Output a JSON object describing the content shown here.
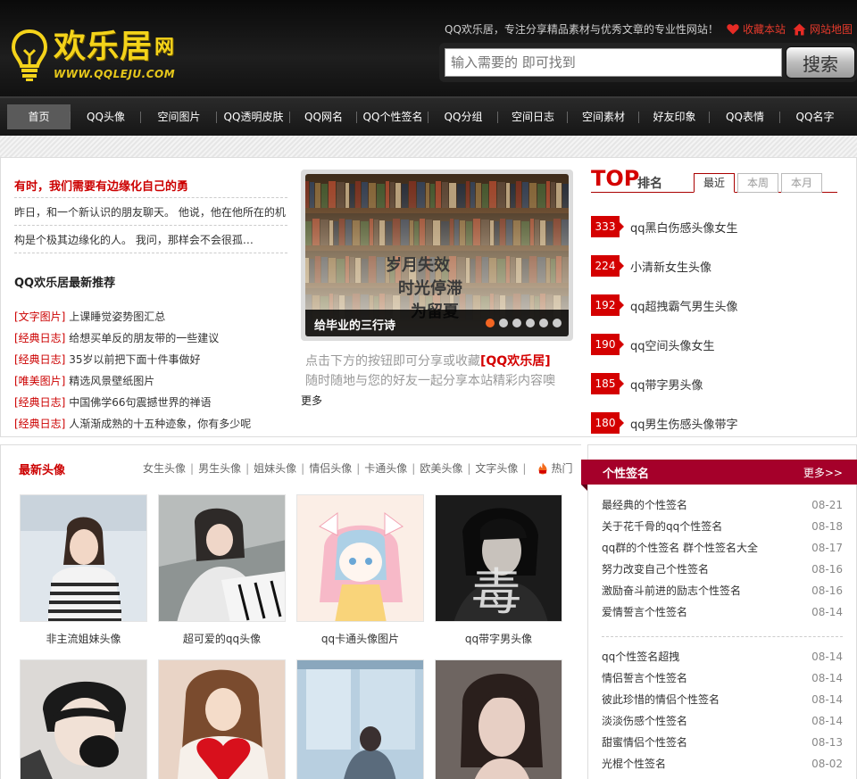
{
  "header": {
    "logo_text": "欢乐居",
    "logo_suffix": "网",
    "logo_url": "WWW.QQLEJU.COM",
    "slogan": "QQ欢乐居，专注分享精品素材与优秀文章的专业性网站！",
    "favorite_label": "收藏本站",
    "sitemap_label": "网站地图",
    "search_placeholder": "输入需要的 即可找到",
    "search_button": "搜索"
  },
  "nav": [
    "首页",
    "QQ头像",
    "空间图片",
    "QQ透明皮肤",
    "QQ网名",
    "QQ个性签名",
    "QQ分组",
    "空间日志",
    "空间素材",
    "好友印象",
    "QQ表情",
    "QQ名字"
  ],
  "lead": {
    "title": "有时，我们需要有边缘化自己的勇",
    "line1": "昨日，和一个新认识的朋友聊天。 他说，他在他所在的机",
    "line2": "构是个极其边缘化的人。 我问，那样会不会很孤…"
  },
  "recommend": {
    "title": "QQ欢乐居最新推荐",
    "items": [
      {
        "cat": "[文字图片]",
        "text": "上课睡觉姿势图汇总"
      },
      {
        "cat": "[经典日志]",
        "text": "给想买单反的朋友带的一些建议"
      },
      {
        "cat": "[经典日志]",
        "text": "35岁以前把下面十件事做好"
      },
      {
        "cat": "[唯美图片]",
        "text": "精选风景壁纸图片"
      },
      {
        "cat": "[经典日志]",
        "text": "中国佛学66句震撼世界的禅语"
      },
      {
        "cat": "[经典日志]",
        "text": "人渐渐成熟的十五种迹象，你有多少呢"
      }
    ]
  },
  "slideshow": {
    "caption": "给毕业的三行诗",
    "poem": [
      "岁月失效",
      "时光停滞",
      "为留夏"
    ],
    "active_index": 0,
    "count": 6
  },
  "share": {
    "line1_prefix": "点击下方的按钮即可分享或收藏",
    "brand": "[QQ欢乐居]",
    "line2": "随时随地与您的好友一起分享本站精彩内容噢",
    "more": "更多"
  },
  "ranking": {
    "title": "TOP",
    "subtitle": "排名",
    "tabs": [
      "最近",
      "本周",
      "本月"
    ],
    "active_tab": 0,
    "items": [
      {
        "count": "333",
        "text": "qq黑白伤感头像女生"
      },
      {
        "count": "224",
        "text": "小清新女生头像"
      },
      {
        "count": "192",
        "text": "qq超拽霸气男生头像"
      },
      {
        "count": "190",
        "text": "qq空间头像女生"
      },
      {
        "count": "185",
        "text": "qq带字男头像"
      },
      {
        "count": "180",
        "text": "qq男生伤感头像带字"
      }
    ]
  },
  "avatars": {
    "title": "最新头像",
    "cats": [
      "女生头像",
      "男生头像",
      "姐妹头像",
      "情侣头像",
      "卡通头像",
      "欧美头像",
      "文字头像"
    ],
    "hot_label": "热门",
    "items": [
      {
        "caption": "非主流姐妹头像"
      },
      {
        "caption": "超可爱的qq头像"
      },
      {
        "caption": "qq卡通头像图片"
      },
      {
        "caption": "qq带字男头像",
        "overlay_char": "毒"
      },
      {
        "caption": ""
      },
      {
        "caption": ""
      },
      {
        "caption": ""
      },
      {
        "caption": ""
      }
    ]
  },
  "signatures": {
    "title": "个性签名",
    "more": "更多>>",
    "group1": [
      {
        "text": "最经典的个性签名",
        "date": "08-21"
      },
      {
        "text": "关于花千骨的qq个性签名",
        "date": "08-18"
      },
      {
        "text": "qq群的个性签名 群个性签名大全",
        "date": "08-17"
      },
      {
        "text": "努力改变自己个性签名",
        "date": "08-16"
      },
      {
        "text": "激励奋斗前进的励志个性签名",
        "date": "08-16"
      },
      {
        "text": "爱情誓言个性签名",
        "date": "08-14"
      }
    ],
    "group2": [
      {
        "text": "qq个性签名超拽",
        "date": "08-14"
      },
      {
        "text": "情侣誓言个性签名",
        "date": "08-14"
      },
      {
        "text": "彼此珍惜的情侣个性签名",
        "date": "08-14"
      },
      {
        "text": "淡淡伤感个性签名",
        "date": "08-14"
      },
      {
        "text": "甜蜜情侣个性签名",
        "date": "08-13"
      },
      {
        "text": "光棍个性签名",
        "date": "08-02"
      }
    ]
  },
  "colors": {
    "accent_red": "#d40000",
    "panel_head": "#a5002a",
    "logo_yellow": "#f4d31a"
  }
}
